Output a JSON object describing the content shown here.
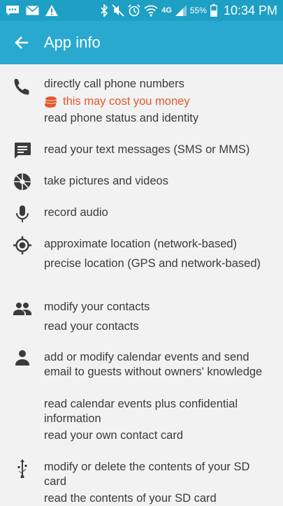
{
  "status_bar": {
    "network_label": "4G",
    "battery_percent": "55%",
    "time": "10:34 PM"
  },
  "app_bar": {
    "title": "App info"
  },
  "permissions": {
    "phone": {
      "icon": "phone-icon",
      "lines": [
        "directly call phone numbers",
        "this may cost you money",
        "read phone status and identity"
      ]
    },
    "sms": {
      "icon": "message-icon",
      "lines": [
        "read your text messages (SMS or MMS)"
      ]
    },
    "camera": {
      "icon": "camera-aperture-icon",
      "lines": [
        "take pictures and videos"
      ]
    },
    "microphone": {
      "icon": "microphone-icon",
      "lines": [
        "record audio"
      ]
    },
    "location": {
      "icon": "location-icon",
      "lines": [
        "approximate location (network-based)",
        "precise location (GPS and network-based)"
      ]
    },
    "contacts": {
      "icon": "contacts-icon",
      "lines": [
        "modify your contacts",
        "read your contacts"
      ]
    },
    "calendar": {
      "icon": "person-icon",
      "lines": [
        "add or modify calendar events and send email to guests without owners' knowledge",
        "read calendar events plus confidential information",
        "read your own contact card"
      ]
    },
    "storage": {
      "icon": "usb-icon",
      "lines": [
        "modify or delete the contents of your SD card",
        "read the contents of your SD card"
      ]
    }
  },
  "colors": {
    "status_bar": "#1e9fc4",
    "app_bar": "#29a9cf",
    "warning": "#e3572b",
    "background": "#f2f2f2",
    "icon": "#3b3b3b"
  }
}
